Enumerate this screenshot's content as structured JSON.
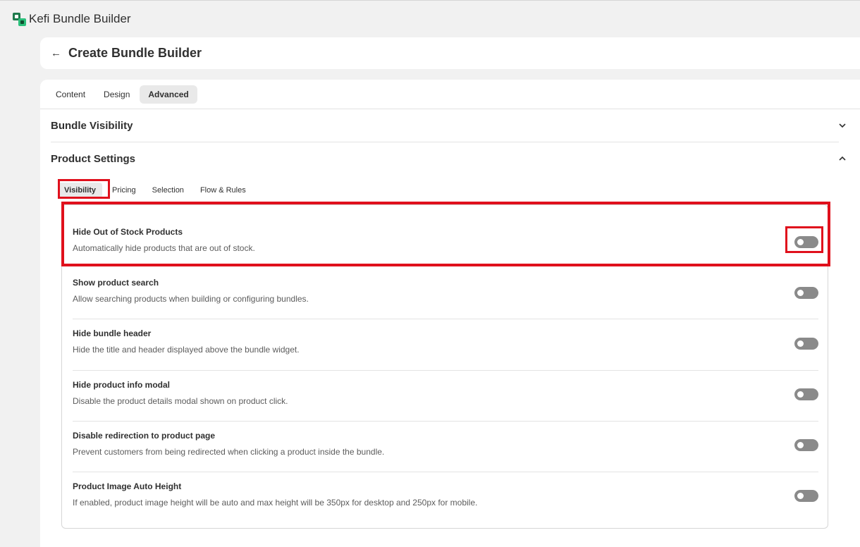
{
  "app": {
    "title": "Kefi Bundle Builder"
  },
  "header": {
    "back_icon": "arrow-left-icon",
    "title": "Create Bundle Builder"
  },
  "tabs": [
    {
      "label": "Content",
      "active": false
    },
    {
      "label": "Design",
      "active": false
    },
    {
      "label": "Advanced",
      "active": true
    }
  ],
  "sections": {
    "bundle_visibility": {
      "title": "Bundle Visibility",
      "expanded": false
    },
    "product_settings": {
      "title": "Product Settings",
      "expanded": true
    }
  },
  "subtabs": [
    {
      "label": "Visibility",
      "active": true
    },
    {
      "label": "Pricing",
      "active": false
    },
    {
      "label": "Selection",
      "active": false
    },
    {
      "label": "Flow & Rules",
      "active": false
    }
  ],
  "settings": [
    {
      "title": "Hide Out of Stock Products",
      "description": "Automatically hide products that are out of stock.",
      "enabled": false
    },
    {
      "title": "Show product search",
      "description": "Allow searching products when building or configuring bundles.",
      "enabled": false
    },
    {
      "title": "Hide bundle header",
      "description": "Hide the title and header displayed above the bundle widget.",
      "enabled": false
    },
    {
      "title": "Hide product info modal",
      "description": "Disable the product details modal shown on product click.",
      "enabled": false
    },
    {
      "title": "Disable redirection to product page",
      "description": "Prevent customers from being redirected when clicking a product inside the bundle.",
      "enabled": false
    },
    {
      "title": "Product Image Auto Height",
      "description": "If enabled, product image height will be auto and max height will be 350px for desktop and 250px for mobile.",
      "enabled": false
    }
  ],
  "colors": {
    "highlight": "#e0101c",
    "toggle_off": "#8a8a8a",
    "page_bg": "#f1f1f1"
  }
}
